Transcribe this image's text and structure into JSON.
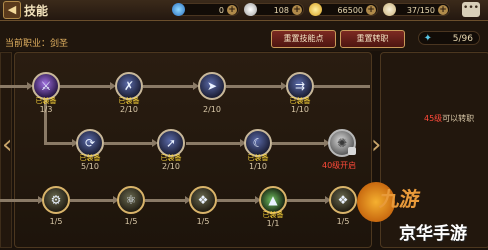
{
  "header": {
    "back_icon": "back-arrow-icon",
    "title": "技能",
    "resources": [
      {
        "icon": "crystal-icon",
        "value": "0"
      },
      {
        "icon": "silver-coin-icon",
        "value": "108"
      },
      {
        "icon": "gold-coin-icon",
        "value": "66500"
      },
      {
        "icon": "stamina-icon",
        "value": "37/150"
      }
    ],
    "chat_icon": "chat-icon"
  },
  "subheader": {
    "current_job": "当前职业：剑圣",
    "reset_skills_label": "重置技能点",
    "reset_transfer_label": "重置转职",
    "skill_points": "5/96"
  },
  "skills": {
    "equipped_label": "已装备",
    "row1": [
      {
        "icon": "sword-slash-icon",
        "level": "1/3",
        "equipped": true
      },
      {
        "icon": "triple-strike-icon",
        "level": "2/10",
        "equipped": true
      },
      {
        "icon": "dash-attack-icon",
        "level": "2/10",
        "equipped": false
      },
      {
        "icon": "arrow-volley-icon",
        "level": "1/10",
        "equipped": true
      }
    ],
    "row2": [
      {
        "icon": "whirlwind-icon",
        "level": "5/10",
        "equipped": true
      },
      {
        "icon": "blade-rush-icon",
        "level": "2/10",
        "equipped": true
      },
      {
        "icon": "crescent-slash-icon",
        "level": "1/10",
        "equipped": true
      },
      {
        "icon": "fire-burst-icon",
        "level": "",
        "equipped": false,
        "locked_text": "40级开启"
      }
    ],
    "row3": [
      {
        "icon": "passive-1-icon",
        "level": "1/5"
      },
      {
        "icon": "passive-2-icon",
        "level": "1/5"
      },
      {
        "icon": "passive-3-icon",
        "level": "1/5"
      },
      {
        "icon": "passive-4-icon",
        "level": "1/1",
        "equipped": true
      },
      {
        "icon": "passive-5-icon",
        "level": "1/5"
      }
    ]
  },
  "transfer_notice": {
    "level": "45级",
    "text": "可以转职"
  },
  "watermark": {
    "logo_text": "九游",
    "text": "京华手游"
  },
  "colors": {
    "accent_gold": "#d9b46a",
    "equipped_yellow": "#ffd83a",
    "locked_red": "#ff4a3a",
    "button_red": "#7c2a22"
  }
}
